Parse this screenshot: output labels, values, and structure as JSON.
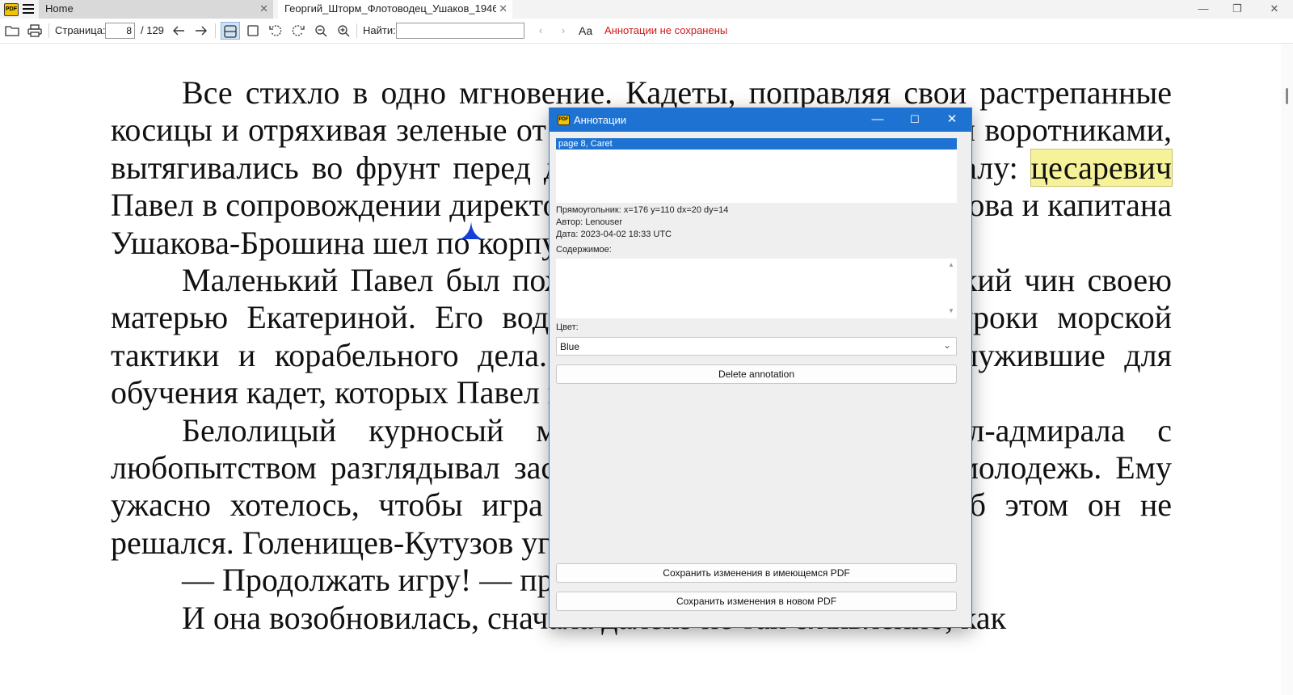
{
  "titlebar": {
    "logo_text": "PDF",
    "tabs": [
      {
        "label": "Home",
        "close": "✕"
      },
      {
        "label": "Георгий_Шторм_Флотоводец_Ушаков_1946 (2)...",
        "close": "✕"
      }
    ],
    "window_controls": {
      "minimize": "—",
      "maximize": "❐",
      "close": "✕"
    }
  },
  "toolbar": {
    "page_label": "Страница:",
    "page_current": "8",
    "page_total": "/ 129",
    "find_label": "Найти:",
    "find_value": "",
    "case_icon_glyph": "Aa",
    "annotation_status": "Аннотации не сохранены",
    "status_color": "#d01818"
  },
  "document": {
    "highlighted_word": "цесаревич",
    "paragraphs": [
      {
        "indent": true,
        "text_before": "Все стихло в одно мгновение. Кадеты, поправляя свои растрепанные косицы и отряхивая зеленые от травы камзолы с обшлагами и воротниками, вытягивались во фрунт перед девятилетнему генерал-адмиралу: ",
        "text_after": " Павел в сопровождении директора корпуса Голенищева-Кутузова и капитана Ушакова-Брошина шел по корпусному двору."
      },
      {
        "indent": true,
        "text": "Маленький Павел был пожалован в генерал-адмиральский чин своею матерью Екатериной. Его водили в Морской корпус на уроки морской тактики и корабельного дела. Модели парусных судов, служившие для обучения кадет, которых Павел видел, очень занимали его..."
      },
      {
        "indent": true,
        "text": "Белолицый курносый мальчик в мундире генерал-адмирала с любопытством разглядывал застывшую в шеренгах линии молодежь. Ему ужасно хотелось, чтобы игра продолжалась, но сказать об этом он не решался. Голенищев-Кутузов угадал его мысли."
      },
      {
        "indent": true,
        "text": "— Продолжать игру! — приказал он кадетам."
      },
      {
        "indent": true,
        "text": "И она возобновилась, сначала далеко не так оживленно, как"
      }
    ]
  },
  "dialog": {
    "logo_text": "PDF",
    "title": "Аннотации",
    "controls": {
      "minimize": "—",
      "maximize": "☐",
      "close": "✕"
    },
    "list_items": [
      "page 8, Caret"
    ],
    "rect_info": "Прямоугольник: x=176 y=110 dx=20 dy=14",
    "author_info": "Автор: Lenouser",
    "date_info": "Дата: 2023-04-02 18:33 UTC",
    "content_label": "Содержимое:",
    "content_value": "",
    "color_label": "Цвет:",
    "color_value": "Blue",
    "delete_button": "Delete annotation",
    "save_existing_button": "Сохранить изменения в имеющемся PDF",
    "save_new_button": "Сохранить изменения в новом PDF",
    "accent_color": "#1e73d2",
    "caret_color": "#1340d8",
    "highlight_color": "#f6f29a"
  }
}
